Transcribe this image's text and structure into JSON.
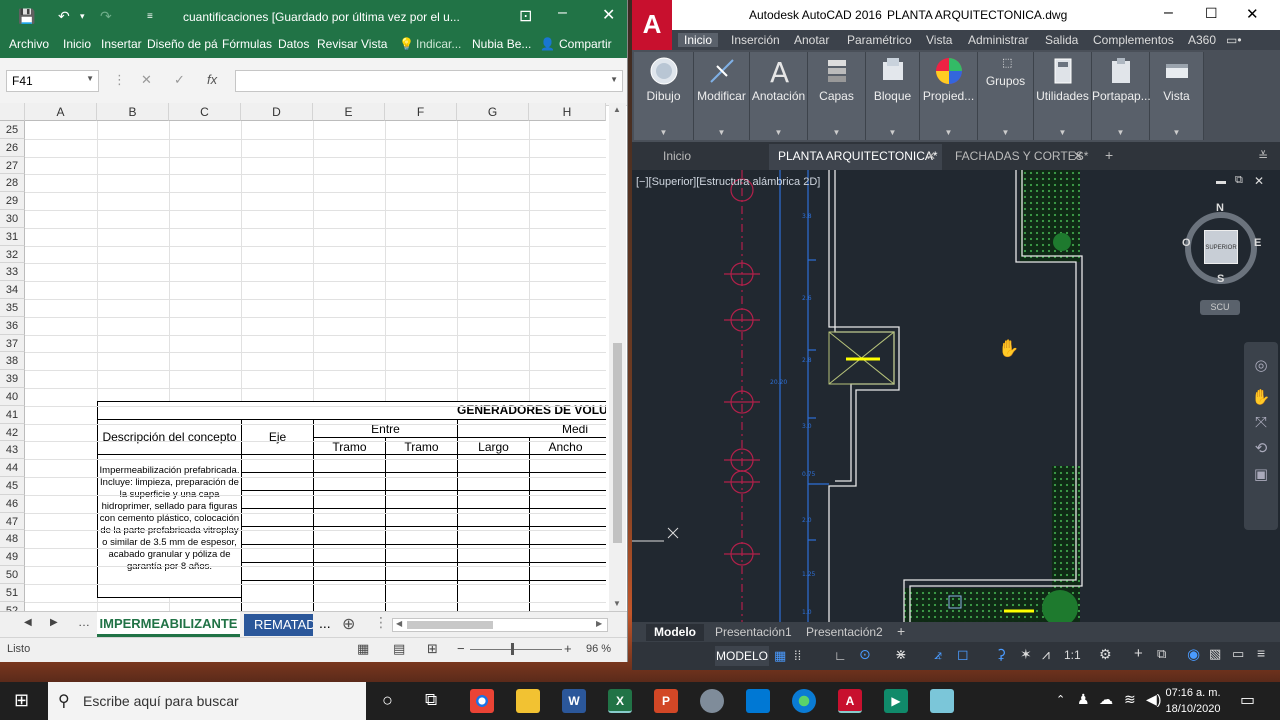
{
  "excel": {
    "filename": "cuantificaciones [Guardado por última vez por el u...",
    "ribbon_tabs": [
      "Archivo",
      "Inicio",
      "Insertar",
      "Diseño de pá",
      "Fórmulas",
      "Datos",
      "Revisar",
      "Vista"
    ],
    "tell_me": "Indicar...",
    "user": "Nubia Be...",
    "share": "Compartir",
    "name_box": "F41",
    "columns": [
      "A",
      "B",
      "C",
      "D",
      "E",
      "F",
      "G",
      "H"
    ],
    "rows": [
      "25",
      "26",
      "27",
      "28",
      "29",
      "30",
      "31",
      "32",
      "33",
      "34",
      "35",
      "36",
      "37",
      "38",
      "39",
      "40",
      "41",
      "42",
      "43",
      "44",
      "45",
      "46",
      "47",
      "48",
      "49",
      "50",
      "51",
      "52"
    ],
    "table": {
      "title": "GENERADORES DE VOLU",
      "descripcion": "Descripción del concepto",
      "eje": "Eje",
      "entre": "Entre",
      "medi": "Medi",
      "tramo1": "Tramo",
      "tramo2": "Tramo",
      "largo": "Largo",
      "ancho": "Ancho",
      "concept_text": "Impermeabilización prefabricada. Incluye: limpieza, preparación de la superficie y una capa hidroprimer, sellado para figuras con cemento plástico, colocación de la parte prefabricada vitroplay o similar de 3.5 mm de espesor, acabado granular y póliza de garantía por 8 años."
    },
    "sheet_tabs": [
      "IMPERMEABILIZANTE",
      "REMATADO"
    ],
    "sheet_more": "...",
    "status": "Listo",
    "zoom": "96 %"
  },
  "autocad": {
    "title": "Autodesk AutoCAD 2016",
    "drawing": "PLANTA ARQUITECTONICA.dwg",
    "logo": "A",
    "ribbon_tabs": [
      "Inicio",
      "Inserción",
      "Anotar",
      "Paramétrico",
      "Vista",
      "Administrar",
      "Salida",
      "Complementos",
      "A360"
    ],
    "panels": [
      "Dibujo",
      "Modificar",
      "Anotación",
      "Capas",
      "Bloque",
      "Propied...",
      "Grupos",
      "Utilidades",
      "Portapap...",
      "Vista"
    ],
    "doc_tabs": [
      "Inicio",
      "PLANTA ARQUITECTONICA*",
      "FACHADAS Y CORTES*"
    ],
    "viewport_label": "[−][Superior][Estructura alámbrica 2D]",
    "viewcube": {
      "n": "N",
      "s": "S",
      "e": "E",
      "o": "O",
      "face": "SUPERIOR",
      "ucs": "SCU"
    },
    "dims": [
      "3.8",
      "2.6",
      "2.8",
      "20.20",
      "3.0",
      "0.75",
      "2.0",
      "1.25",
      "1.0"
    ],
    "layout_tabs": [
      "Modelo",
      "Presentación1",
      "Presentación2"
    ],
    "status_model": "MODELO",
    "scale": "1:1"
  },
  "taskbar": {
    "search_placeholder": "Escribe aquí para buscar",
    "time": "07:16 a. m.",
    "date": "18/10/2020"
  }
}
